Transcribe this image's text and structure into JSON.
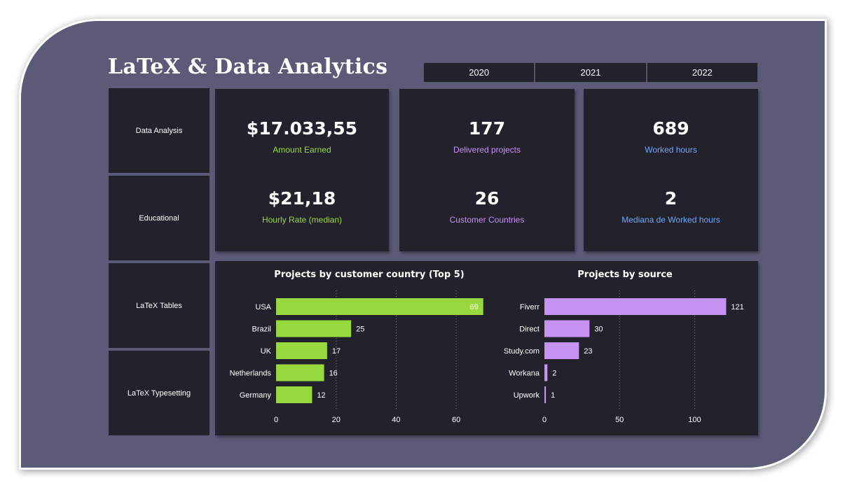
{
  "header": {
    "title": "LaTeX & Data Analytics"
  },
  "years": [
    "2020",
    "2021",
    "2022"
  ],
  "categories": [
    "Data Analysis",
    "Educational",
    "LaTeX Tables",
    "LaTeX Typesetting"
  ],
  "kpis": {
    "amount_earned": {
      "value": "$17.033,55",
      "label": "Amount Earned"
    },
    "hourly_rate": {
      "value": "$21,18",
      "label": "Hourly Rate (median)"
    },
    "delivered_projects": {
      "value": "177",
      "label": "Delivered projects"
    },
    "customer_countries": {
      "value": "26",
      "label": "Customer Countries"
    },
    "worked_hours": {
      "value": "689",
      "label": "Worked hours"
    },
    "median_worked_hours": {
      "value": "2",
      "label": "Mediana de Worked hours"
    }
  },
  "colors": {
    "green": "#98d93f",
    "purple": "#c592f2",
    "blue": "#74a7f7",
    "panel": "#23222c",
    "frame": "#5b5b78"
  },
  "chart_data": [
    {
      "type": "bar",
      "orientation": "horizontal",
      "title": "Projects by customer country (Top 5)",
      "categories": [
        "USA",
        "Brazil",
        "UK",
        "Netherlands",
        "Germany"
      ],
      "values": [
        69,
        25,
        17,
        16,
        12
      ],
      "xlim": [
        0,
        70
      ],
      "xticks": [
        0,
        20,
        40,
        60
      ],
      "color": "#98d93f",
      "grid": true
    },
    {
      "type": "bar",
      "orientation": "horizontal",
      "title": "Projects by source",
      "categories": [
        "Fiverr",
        "Direct",
        "Study.com",
        "Workana",
        "Upwork"
      ],
      "values": [
        121,
        30,
        23,
        2,
        1
      ],
      "xlim": [
        0,
        125
      ],
      "xticks": [
        0,
        50,
        100
      ],
      "color": "#c592f2",
      "grid": true
    }
  ]
}
